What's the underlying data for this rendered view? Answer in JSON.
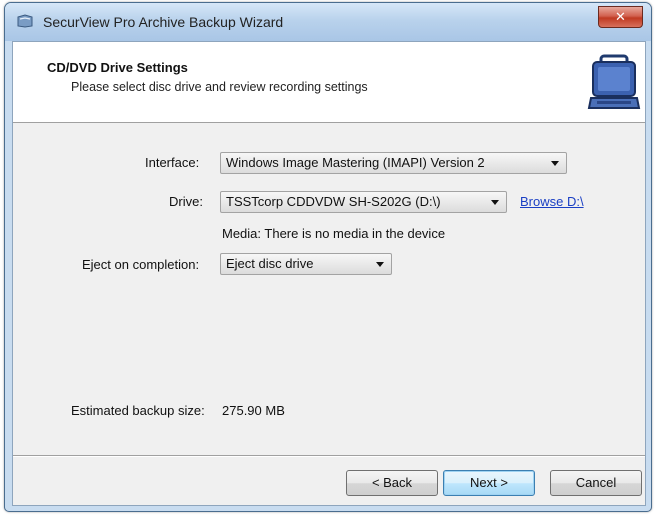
{
  "window": {
    "title": "SecurView Pro Archive Backup Wizard",
    "close_glyph": "✕"
  },
  "header": {
    "title": "CD/DVD Drive Settings",
    "subtitle": "Please select disc drive and review recording settings"
  },
  "form": {
    "interface_label": "Interface:",
    "interface_value": "Windows Image Mastering (IMAPI) Version 2",
    "drive_label": "Drive:",
    "drive_value": "TSSTcorp CDDVDW SH-S202G  (D:\\)",
    "browse_link": "Browse D:\\",
    "media_status": "Media: There is no media in the device",
    "eject_label": "Eject on completion:",
    "eject_value": "Eject disc drive",
    "estimated_label": "Estimated backup size:",
    "estimated_value": "275.90 MB"
  },
  "buttons": {
    "back": "< Back",
    "next": "Next >",
    "cancel": "Cancel"
  },
  "icons": {
    "app": "app-icon",
    "header": "portable-computer-icon",
    "dropdown": "chevron-down-icon"
  }
}
